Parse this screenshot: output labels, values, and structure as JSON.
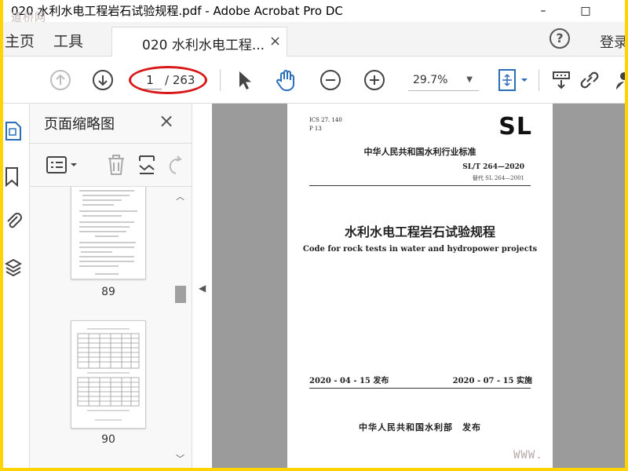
{
  "window": {
    "title": "020 水利水电工程岩石试验规程.pdf - Adobe Acrobat Pro DC",
    "minimize": "–",
    "maximize": "□"
  },
  "watermark_top": "道桥网",
  "watermark_bottom": "WWW.",
  "tabs": {
    "home": "主页",
    "tools": "工具",
    "document": "020 水利水电工程...",
    "close": "×",
    "help": "?",
    "login": "登录"
  },
  "toolbar": {
    "current_page": "1",
    "total_pages": "/ 263",
    "zoom": "29.7%"
  },
  "panel": {
    "title": "页面缩略图",
    "close": "×",
    "thumbnails": [
      {
        "page": "89"
      },
      {
        "page": "90"
      }
    ]
  },
  "document_page": {
    "ics": "ICS 27. 140",
    "p": "P 13",
    "logo": "SL",
    "standard_type": "中华人民共和国水利行业标准",
    "code": "SL/T 264—2020",
    "replaces": "替代 SL 264—2001",
    "title_cn": "水利水电工程岩石试验规程",
    "title_en": "Code for rock tests in water and hydropower projects",
    "issue_date": "2020 - 04 - 15 发布",
    "implement_date": "2020 - 07 - 15 实施",
    "publisher": "中华人民共和国水利部　发布"
  },
  "colors": {
    "frame_border": "#ffd400",
    "annotation_oval": "#d81818",
    "accent_blue": "#2a6ebb",
    "doc_background": "#9b9b9b"
  },
  "icons": [
    "arrow-up-circle-icon",
    "arrow-down-circle-icon",
    "select-arrow-icon",
    "hand-icon",
    "zoom-out-icon",
    "zoom-in-icon",
    "fit-page-icon",
    "tools-icon",
    "link-icon",
    "user-icon",
    "page-thumbnails-icon",
    "bookmark-icon",
    "attachment-icon",
    "layers-icon",
    "options-icon",
    "trash-icon",
    "extract-icon",
    "rotate-icon"
  ]
}
